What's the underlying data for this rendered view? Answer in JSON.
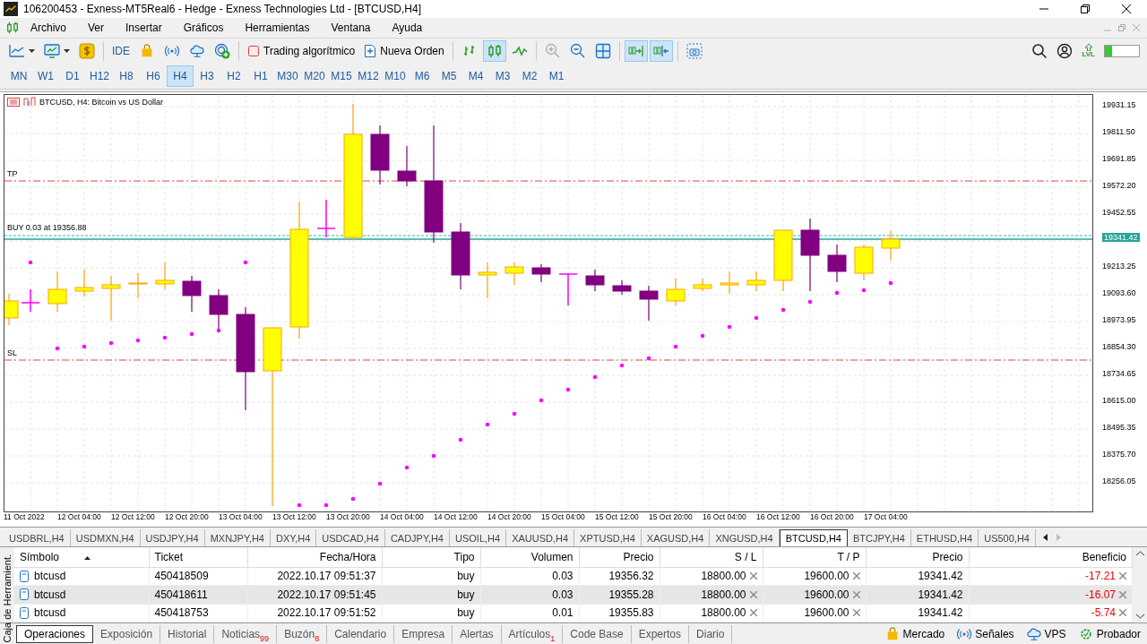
{
  "window": {
    "title": "106200453 - Exness-MT5Real6 - Hedge - Exness Technologies Ltd - [BTCUSD,H4]"
  },
  "menu": [
    "Archivo",
    "Ver",
    "Insertar",
    "Gráficos",
    "Herramientas",
    "Ventana",
    "Ayuda"
  ],
  "toolbar": {
    "ide": "IDE",
    "algo_trading": "Trading algorítmico",
    "new_order": "Nueva Orden",
    "chart_types": [
      {
        "kind": "bars",
        "selected": false
      },
      {
        "kind": "candles",
        "selected": true
      },
      {
        "kind": "line",
        "selected": false
      }
    ],
    "autoscroll": {
      "selected": true
    },
    "chart_shift": {
      "selected": true
    },
    "level_label": "LVL",
    "level": 0.22
  },
  "timeframes": [
    {
      "label": "MN",
      "selected": false
    },
    {
      "label": "W1",
      "selected": false
    },
    {
      "label": "D1",
      "selected": false
    },
    {
      "label": "H12",
      "selected": false
    },
    {
      "label": "H8",
      "selected": false
    },
    {
      "label": "H6",
      "selected": false
    },
    {
      "label": "H4",
      "selected": true
    },
    {
      "label": "H3",
      "selected": false
    },
    {
      "label": "H2",
      "selected": false
    },
    {
      "label": "H1",
      "selected": false
    },
    {
      "label": "M30",
      "selected": false
    },
    {
      "label": "M20",
      "selected": false
    },
    {
      "label": "M15",
      "selected": false
    },
    {
      "label": "M12",
      "selected": false
    },
    {
      "label": "M10",
      "selected": false
    },
    {
      "label": "M6",
      "selected": false
    },
    {
      "label": "M5",
      "selected": false
    },
    {
      "label": "M4",
      "selected": false
    },
    {
      "label": "M3",
      "selected": false
    },
    {
      "label": "M2",
      "selected": false
    },
    {
      "label": "M1",
      "selected": false
    }
  ],
  "chart": {
    "header": "BTCUSD, H4:  Bitcoin vs US Dollar",
    "tp_label": "TP",
    "sl_label": "SL",
    "position_label": "BUY 0.03 at 19356.88",
    "current_price": "19341.42",
    "price_ticks": [
      "19931.15",
      "19811.50",
      "19691.85",
      "19572.20",
      "19452.55",
      "19213.25",
      "19093.60",
      "18973.95",
      "18854.30",
      "18734.65",
      "18615.00",
      "18495.35",
      "18375.70",
      "18256.05"
    ],
    "time_ticks": [
      "11 Oct 2022",
      "12 Oct 04:00",
      "12 Oct 12:00",
      "12 Oct 20:00",
      "13 Oct 04:00",
      "13 Oct 12:00",
      "13 Oct 20:00",
      "14 Oct 04:00",
      "14 Oct 12:00",
      "14 Oct 20:00",
      "15 Oct 04:00",
      "15 Oct 12:00",
      "15 Oct 20:00",
      "16 Oct 04:00",
      "16 Oct 12:00",
      "16 Oct 20:00",
      "17 Oct 04:00"
    ]
  },
  "symbol_tabs": [
    {
      "label": "USDBRL,H4",
      "selected": false
    },
    {
      "label": "USDMXN,H4",
      "selected": false
    },
    {
      "label": "USDJPY,H4",
      "selected": false
    },
    {
      "label": "MXNJPY,H4",
      "selected": false
    },
    {
      "label": "DXY,H4",
      "selected": false
    },
    {
      "label": "USDCAD,H4",
      "selected": false
    },
    {
      "label": "CADJPY,H4",
      "selected": false
    },
    {
      "label": "USOIL,H4",
      "selected": false
    },
    {
      "label": "XAUUSD,H4",
      "selected": false
    },
    {
      "label": "XPTUSD,H4",
      "selected": false
    },
    {
      "label": "XAGUSD,H4",
      "selected": false
    },
    {
      "label": "XNGUSD,H4",
      "selected": false
    },
    {
      "label": "BTCUSD,H4",
      "selected": true
    },
    {
      "label": "BTCJPY,H4",
      "selected": false
    },
    {
      "label": "ETHUSD,H4",
      "selected": false
    },
    {
      "label": "US500,H4",
      "selected": false
    }
  ],
  "toolbox": {
    "side_label": "Caja de Herramient.",
    "columns": [
      {
        "label": "Símbolo",
        "sorted": true
      },
      {
        "label": "Ticket",
        "sorted": false
      },
      {
        "label": "Fecha/Hora",
        "sorted": false
      },
      {
        "label": "Tipo",
        "sorted": false
      },
      {
        "label": "Volumen",
        "sorted": false
      },
      {
        "label": "Precio",
        "sorted": false
      },
      {
        "label": "S / L",
        "sorted": false
      },
      {
        "label": "T / P",
        "sorted": false
      },
      {
        "label": "Precio",
        "sorted": false
      },
      {
        "label": "Beneficio",
        "sorted": false
      }
    ],
    "rows": [
      {
        "selected": false,
        "cells": [
          "btcusd",
          "450418509",
          "2022.10.17 09:51:37",
          "buy",
          "0.03",
          "19356.32",
          "18800.00",
          "19600.00",
          "19341.42",
          "-17.21"
        ]
      },
      {
        "selected": true,
        "cells": [
          "btcusd",
          "450418611",
          "2022.10.17 09:51:45",
          "buy",
          "0.03",
          "19355.28",
          "18800.00",
          "19600.00",
          "19341.42",
          "-16.07"
        ]
      },
      {
        "selected": false,
        "cells": [
          "btcusd",
          "450418753",
          "2022.10.17 09:51:52",
          "buy",
          "0.01",
          "19355.83",
          "18800.00",
          "19600.00",
          "19341.42",
          "-5.74"
        ]
      }
    ],
    "tabs": [
      {
        "label": "Operaciones",
        "selected": true
      },
      {
        "label": "Exposición",
        "selected": false
      },
      {
        "label": "Historial",
        "selected": false
      },
      {
        "label": "Noticias",
        "badge": "99",
        "selected": false
      },
      {
        "label": "Buzón",
        "badge": "8",
        "selected": false
      },
      {
        "label": "Calendario",
        "selected": false
      },
      {
        "label": "Empresa",
        "selected": false
      },
      {
        "label": "Alertas",
        "selected": false
      },
      {
        "label": "Artículos",
        "badge": "1",
        "selected": false
      },
      {
        "label": "Code Base",
        "selected": false
      },
      {
        "label": "Expertos",
        "selected": false
      },
      {
        "label": "Diario",
        "selected": false
      }
    ],
    "services": [
      {
        "kind": "market",
        "label": "Mercado"
      },
      {
        "kind": "signals",
        "label": "Señales"
      },
      {
        "kind": "vps",
        "label": "VPS"
      },
      {
        "kind": "tester",
        "label": "Probador"
      }
    ]
  }
}
